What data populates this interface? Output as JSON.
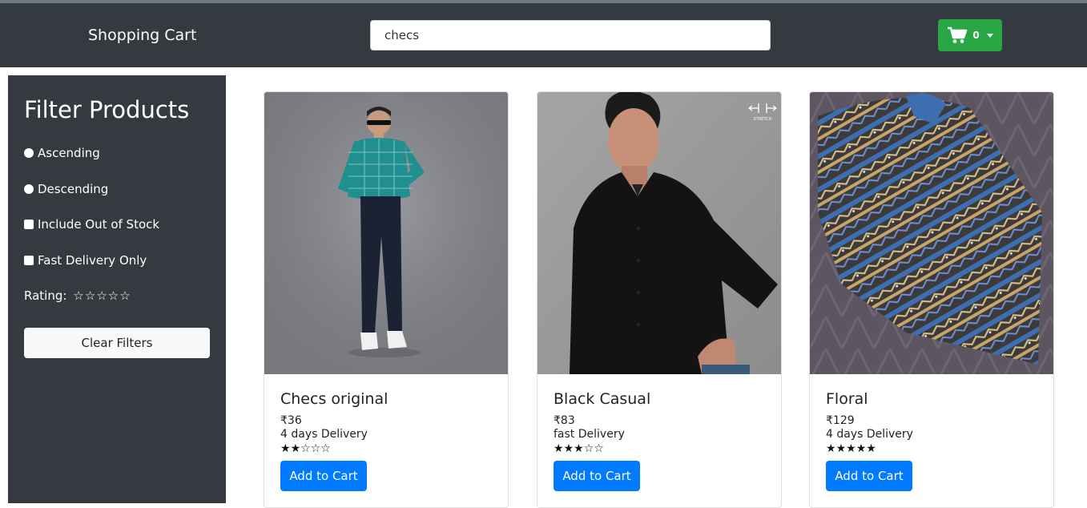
{
  "header": {
    "brand": "Shopping Cart",
    "search_value": "checs",
    "cart_count": "0"
  },
  "sidebar": {
    "title": "Filter Products",
    "options": [
      {
        "label": "Ascending",
        "type": "radio"
      },
      {
        "label": "Descending",
        "type": "radio"
      },
      {
        "label": "Include Out of Stock",
        "type": "checkbox"
      },
      {
        "label": "Fast Delivery Only",
        "type": "checkbox"
      }
    ],
    "rating_label": "Rating:",
    "rating_stars": [
      "☆",
      "☆",
      "☆",
      "☆",
      "☆"
    ],
    "clear_label": "Clear Filters"
  },
  "products": [
    {
      "name": "Checs original",
      "price": "₹36",
      "delivery": "4 days Delivery",
      "rating": 2,
      "stars": [
        "★",
        "★",
        "☆",
        "☆",
        "☆"
      ],
      "button": "Add to Cart"
    },
    {
      "name": "Black Casual",
      "price": "₹83",
      "delivery": "fast Delivery",
      "rating": 3,
      "stars": [
        "★",
        "★",
        "★",
        "☆",
        "☆"
      ],
      "button": "Add to Cart"
    },
    {
      "name": "Floral",
      "price": "₹129",
      "delivery": "4 days Delivery",
      "rating": 5,
      "stars": [
        "★",
        "★",
        "★",
        "★",
        "★"
      ],
      "button": "Add to Cart"
    }
  ],
  "colors": {
    "navbar": "#343a40",
    "cart_button": "#28a745",
    "add_button": "#007bff"
  }
}
